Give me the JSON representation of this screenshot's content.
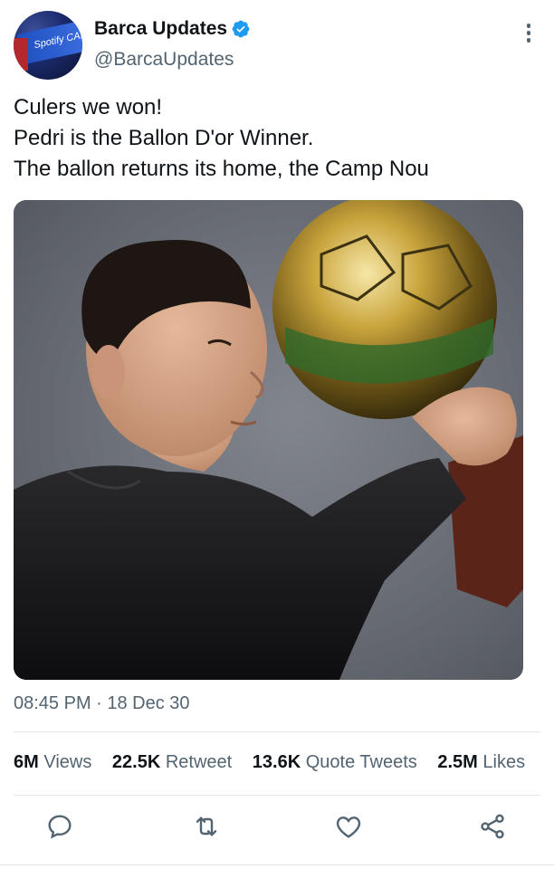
{
  "author": {
    "display_name": "Barca Updates",
    "handle": "@BarcaUpdates",
    "verified": true,
    "avatar_banner_text": "Spotify CAM"
  },
  "tweet": {
    "text_lines": [
      "Culers we won!",
      "Pedri is the Ballon D'or Winner.",
      "The ballon returns its home, the Camp Nou"
    ],
    "timestamp": "08:45 PM · 18 Dec 30"
  },
  "stats": [
    {
      "value": "6M",
      "label": "Views"
    },
    {
      "value": "22.5K",
      "label": "Retweet"
    },
    {
      "value": "13.6K",
      "label": "Quote Tweets"
    },
    {
      "value": "2.5M",
      "label": "Likes"
    }
  ],
  "actions": [
    {
      "name": "reply",
      "icon": "reply-icon"
    },
    {
      "name": "retweet",
      "icon": "retweet-icon"
    },
    {
      "name": "like",
      "icon": "heart-icon"
    },
    {
      "name": "share",
      "icon": "share-icon"
    }
  ],
  "colors": {
    "text": "#0f1419",
    "secondary": "#536471",
    "verified": "#1d9bf0",
    "divider": "#e1e6ea"
  }
}
